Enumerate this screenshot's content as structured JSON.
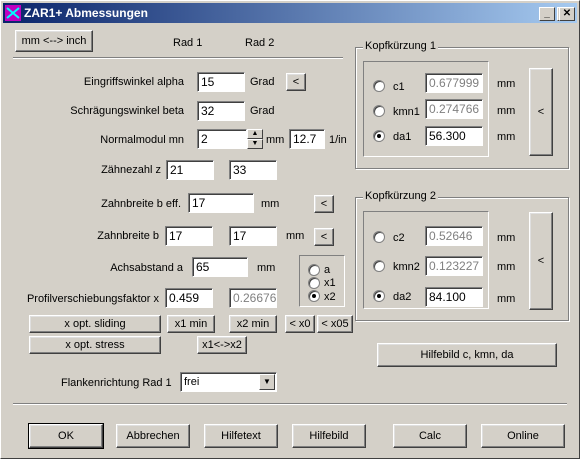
{
  "window": {
    "title": "ZAR1+ Abmessungen",
    "min": "_",
    "max": "□",
    "close": "✕"
  },
  "unit_toggle": "mm <--> inch",
  "col_headers": {
    "rad1": "Rad 1",
    "rad2": "Rad 2"
  },
  "eingriffswinkel": {
    "label": "Eingriffswinkel alpha",
    "value": "15",
    "unit": "Grad",
    "btn": "<"
  },
  "schraeg": {
    "label": "Schrägungswinkel beta",
    "value": "32",
    "unit": "Grad"
  },
  "normalmodul": {
    "label": "Normalmodul mn",
    "value": "2",
    "unit": "mm",
    "inch_value": "12.7",
    "inch_unit": "1/in"
  },
  "zaehnezahl": {
    "label": "Zähnezahl z",
    "rad1": "21",
    "rad2": "33"
  },
  "zahnbreite_eff": {
    "label": "Zahnbreite b eff.",
    "value": "17",
    "unit": "mm",
    "btn": "<"
  },
  "zahnbreite": {
    "label": "Zahnbreite b",
    "rad1": "17",
    "rad2": "17",
    "unit": "mm",
    "btn": "<"
  },
  "achsabstand": {
    "label": "Achsabstand a",
    "value": "65",
    "unit": "mm"
  },
  "achs_radio": {
    "a": "a",
    "x1": "x1",
    "x2": "x2",
    "selected": "x2"
  },
  "profil": {
    "label": "Profilverschiebungsfaktor x",
    "rad1": "0.459",
    "rad2": "0.26676"
  },
  "buttons_row": {
    "x_opt_sliding": "x opt. sliding",
    "x1_min": "x1 min",
    "x2_min": "x2 min",
    "x0": "< x0",
    "x05": "< x05",
    "x_opt_stress": "x opt. stress",
    "swap": "x1<->x2"
  },
  "kopf1": {
    "title": "Kopfkürzung 1",
    "c_label": "c1",
    "c_value": "0.677999",
    "c_unit": "mm",
    "kmn_label": "kmn1",
    "kmn_value": "0.274766",
    "kmn_unit": "mm",
    "da_label": "da1",
    "da_value": "56.300",
    "da_unit": "mm",
    "selected": "da1",
    "btn": "<"
  },
  "kopf2": {
    "title": "Kopfkürzung 2",
    "c_label": "c2",
    "c_value": "0.52646",
    "c_unit": "mm",
    "kmn_label": "kmn2",
    "kmn_value": "0.123227",
    "kmn_unit": "mm",
    "da_label": "da2",
    "da_value": "84.100",
    "da_unit": "mm",
    "selected": "da2",
    "btn": "<"
  },
  "hilfebild_c": "Hilfebild c, kmn, da",
  "flanken": {
    "label": "Flankenrichtung Rad 1",
    "value": "frei"
  },
  "bottom": {
    "ok": "OK",
    "abbrechen": "Abbrechen",
    "hilfetext": "Hilfetext",
    "hilfebild": "Hilfebild",
    "calc": "Calc",
    "online": "Online"
  }
}
